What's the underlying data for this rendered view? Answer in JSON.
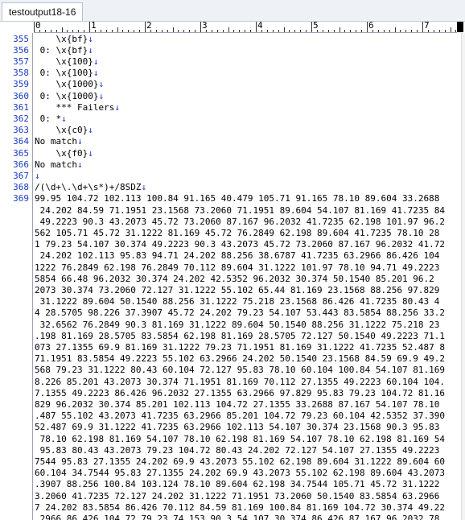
{
  "tab": {
    "label": "testoutput18-16"
  },
  "ruler": {
    "marks": [
      "0",
      "1",
      "2",
      "3",
      "4",
      "5",
      "6",
      "7"
    ]
  },
  "eol_symbol": "↓",
  "colors": {
    "line_number": "#1a3cc4",
    "eol": "#1a3cc4",
    "text": "#000000"
  },
  "lines": [
    {
      "num": "355",
      "text": "    \\x{bf}",
      "eol": true
    },
    {
      "num": "356",
      "text": " 0: \\x{bf}",
      "eol": true
    },
    {
      "num": "357",
      "text": "    \\x{100}",
      "eol": true
    },
    {
      "num": "358",
      "text": " 0: \\x{100}",
      "eol": true
    },
    {
      "num": "359",
      "text": "    \\x{1000}",
      "eol": true
    },
    {
      "num": "360",
      "text": " 0: \\x{1000}",
      "eol": true
    },
    {
      "num": "361",
      "text": "    *** Failers",
      "eol": true
    },
    {
      "num": "362",
      "text": " 0: *",
      "eol": true
    },
    {
      "num": "363",
      "text": "    \\x{c0}",
      "eol": true
    },
    {
      "num": "364",
      "text": "No match",
      "eol": true
    },
    {
      "num": "365",
      "text": "    \\x{f0}",
      "eol": true
    },
    {
      "num": "366",
      "text": "No match",
      "eol": true
    },
    {
      "num": "367",
      "text": "",
      "eol": true
    },
    {
      "num": "368",
      "text": "/(\\d+\\.\\d+\\s*)+/8SDZ",
      "eol": true
    },
    {
      "num": "369",
      "text": "99.95 104.72 102.113 100.84 91.165 40.479 105.71 91.165 78.10 89.604 33.2688",
      "eol": false
    },
    {
      "num": "",
      "text": " 24.202 84.59 71.1951 23.1568 73.2060 71.1951 89.604 54.107 81.169 41.7235 84",
      "eol": false
    },
    {
      "num": "",
      "text": " 49.2223 90.3 43.2073 45.72 73.2060 87.167 96.2032 41.7235 62.198 101.97 96.2",
      "eol": false
    },
    {
      "num": "",
      "text": "562 105.71 45.72 31.1222 81.169 45.72 76.2849 62.198 89.604 41.7235 78.10 28",
      "eol": false
    },
    {
      "num": "",
      "text": "1 79.23 54.107 30.374 49.2223 90.3 43.2073 45.72 73.2060 87.167 96.2032 41.72",
      "eol": false
    },
    {
      "num": "",
      "text": " 24.202 102.113 95.83 94.71 24.202 88.256 38.6787 41.7235 63.2966 86.426 104",
      "eol": false
    },
    {
      "num": "",
      "text": "1222 76.2849 62.198 76.2849 70.112 89.604 31.1222 101.97 78.10 94.71 49.2223",
      "eol": false
    },
    {
      "num": "",
      "text": "5854 66.48 96.2032 30.374 24.202 42.5352 96.2032 30.374 50.1540 85.201 96.2",
      "eol": false
    },
    {
      "num": "",
      "text": "2073 30.374 73.2060 72.127 31.1222 55.102 65.44 81.169 23.1568 88.256 97.829",
      "eol": false
    },
    {
      "num": "",
      "text": " 31.1222 89.604 50.1540 88.256 31.1222 75.218 23.1568 86.426 41.7235 80.43 4",
      "eol": false
    },
    {
      "num": "",
      "text": "4 28.5705 98.226 37.3907 45.72 24.202 79.23 54.107 53.443 83.5854 88.256 33.2",
      "eol": false
    },
    {
      "num": "",
      "text": " 32.6562 76.2849 90.3 81.169 31.1222 89.604 50.1540 88.256 31.1222 75.218 23",
      "eol": false
    },
    {
      "num": "",
      "text": ".198 81.169 28.5705 83.5854 62.198 81.169 28.5705 72.127 50.1540 49.2223 71.1",
      "eol": false
    },
    {
      "num": "",
      "text": "073 27.1355 69.9 81.169 31.1222 79.23 71.1951 81.169 31.1222 41.7235 52.487 8",
      "eol": false
    },
    {
      "num": "",
      "text": "71.1951 83.5854 49.2223 55.102 63.2966 24.202 50.1540 23.1568 84.59 69.9 49.2",
      "eol": false
    },
    {
      "num": "",
      "text": "568 79.23 31.1222 80.43 60.104 72.127 95.83 78.10 60.104 100.84 54.107 81.169",
      "eol": false
    },
    {
      "num": "",
      "text": "8.226 85.201 43.2073 30.374 71.1951 81.169 70.112 27.1355 49.2223 60.104 104.",
      "eol": false
    },
    {
      "num": "",
      "text": "7.1355 49.2223 86.426 96.2032 27.1355 63.2966 97.829 95.83 79.23 104.72 81.16",
      "eol": false
    },
    {
      "num": "",
      "text": "829 96.2032 30.374 85.201 102.113 104.72 27.1355 33.2688 87.167 54.107 78.10",
      "eol": false
    },
    {
      "num": "",
      "text": ".487 55.102 43.2073 41.7235 63.2966 85.201 104.72 79.23 60.104 42.5352 37.390",
      "eol": false
    },
    {
      "num": "",
      "text": "52.487 69.9 31.1222 41.7235 63.2966 102.113 54.107 30.374 23.1568 90.3 95.83",
      "eol": false
    },
    {
      "num": "",
      "text": " 78.10 62.198 81.169 54.107 78.10 62.198 81.169 54.107 78.10 62.198 81.169 54",
      "eol": false
    },
    {
      "num": "",
      "text": " 95.83 80.43 43.2073 79.23 104.72 80.43 24.202 72.127 54.107 27.1355 49.2223",
      "eol": false
    },
    {
      "num": "",
      "text": "7544 95.83 27.1355 24.202 69.9 43.2073 55.102 62.198 89.604 31.1222 89.604 60",
      "eol": false
    },
    {
      "num": "",
      "text": "60.104 34.7544 95.83 27.1355 24.202 69.9 43.2073 55.102 62.198 89.604 43.2073",
      "eol": false
    },
    {
      "num": "",
      "text": ".3907 88.256 100.84 103.124 78.10 89.604 62.198 34.7544 105.71 45.72 31.1222",
      "eol": false
    },
    {
      "num": "",
      "text": "3.2060 41.7235 72.127 24.202 31.1222 71.1951 73.2060 50.1540 83.5854 63.2966",
      "eol": false
    },
    {
      "num": "",
      "text": "7 24.202 83.5854 86.426 70.112 84.59 81.169 100.84 81.169 104.72 30.374 49.22",
      "eol": false
    },
    {
      "num": "",
      "text": ".2966 86.426 104.72 79.23 74.153 90.3 54.107 30.374 86.426 87.167 96.2032 78",
      "eol": false
    }
  ]
}
